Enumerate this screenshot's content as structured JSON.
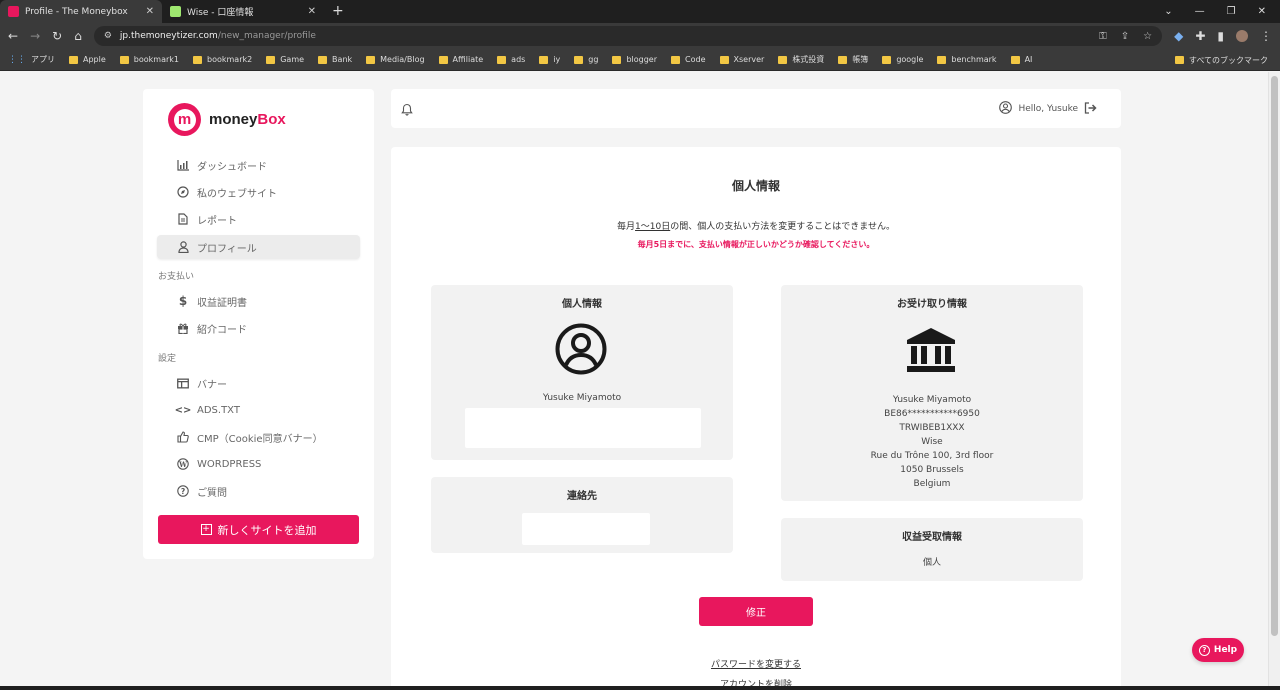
{
  "browser": {
    "tabs": [
      {
        "title": "Profile - The Moneybox",
        "favicon_color": "#e8175d",
        "active": true
      },
      {
        "title": "Wise - 口座情報",
        "favicon_color": "#9fe870",
        "active": false
      }
    ],
    "url_host": "jp.themoneytizer.com",
    "url_path": "/new_manager/profile",
    "bookmarks": [
      "アプリ",
      "Apple",
      "bookmark1",
      "bookmark2",
      "Game",
      "Bank",
      "Media/Blog",
      "Affiliate",
      "ads",
      "iy",
      "gg",
      "blogger",
      "Code",
      "Xserver",
      "株式投資",
      "帳簿",
      "google",
      "benchmark",
      "AI"
    ],
    "all_bookmarks": "すべてのブックマーク"
  },
  "brand": {
    "primary": "#e8175d",
    "logo_letter": "m",
    "name_part1": "money",
    "name_part2": "Box"
  },
  "sidebar": {
    "items": [
      {
        "label": "ダッシュボード",
        "icon": "bar-chart-icon"
      },
      {
        "label": "私のウェブサイト",
        "icon": "compass-icon"
      },
      {
        "label": "レポート",
        "icon": "document-icon"
      },
      {
        "label": "プロフィール",
        "icon": "user-icon"
      }
    ],
    "section_payment": "お支払い",
    "payment_items": [
      {
        "label": "収益証明書",
        "icon": "dollar-icon"
      },
      {
        "label": "紹介コード",
        "icon": "gift-icon"
      }
    ],
    "section_settings": "設定",
    "settings_items": [
      {
        "label": "バナー",
        "icon": "banner-icon"
      },
      {
        "label": "ADS.TXT",
        "icon": "code-icon"
      },
      {
        "label": "CMP（Cookie同意バナー）",
        "icon": "thumbs-up-icon"
      },
      {
        "label": "WORDPRESS",
        "icon": "wordpress-icon"
      },
      {
        "label": "ご質問",
        "icon": "question-icon"
      }
    ],
    "add_site_label": "新しくサイトを追加"
  },
  "header": {
    "greeting": "Hello, Yusuke"
  },
  "main": {
    "title": "個人情報",
    "notice_prefix": "毎月",
    "notice_underlined": "1〜10日",
    "notice_suffix": "の間、個人の支払い方法を変更することはできません。",
    "notice_warning": "毎月5日までに、支払い情報が正しいかどうか確認してください。",
    "personal_card": {
      "title": "個人情報",
      "name": "Yusuke Miyamoto"
    },
    "contact_card": {
      "title": "連絡先"
    },
    "receipt_card": {
      "title": "お受け取り情報",
      "lines": [
        "Yusuke Miyamoto",
        "BE86***********6950",
        "TRWIBEB1XXX",
        "Wise",
        "Rue du Trône 100, 3rd floor",
        "1050 Brussels",
        "Belgium"
      ]
    },
    "revenue_card": {
      "title": "収益受取情報",
      "value": "個人"
    },
    "edit_button": "修正",
    "change_password": "パスワードを変更する",
    "delete_account": "アカウントを削除"
  },
  "help_label": "Help"
}
